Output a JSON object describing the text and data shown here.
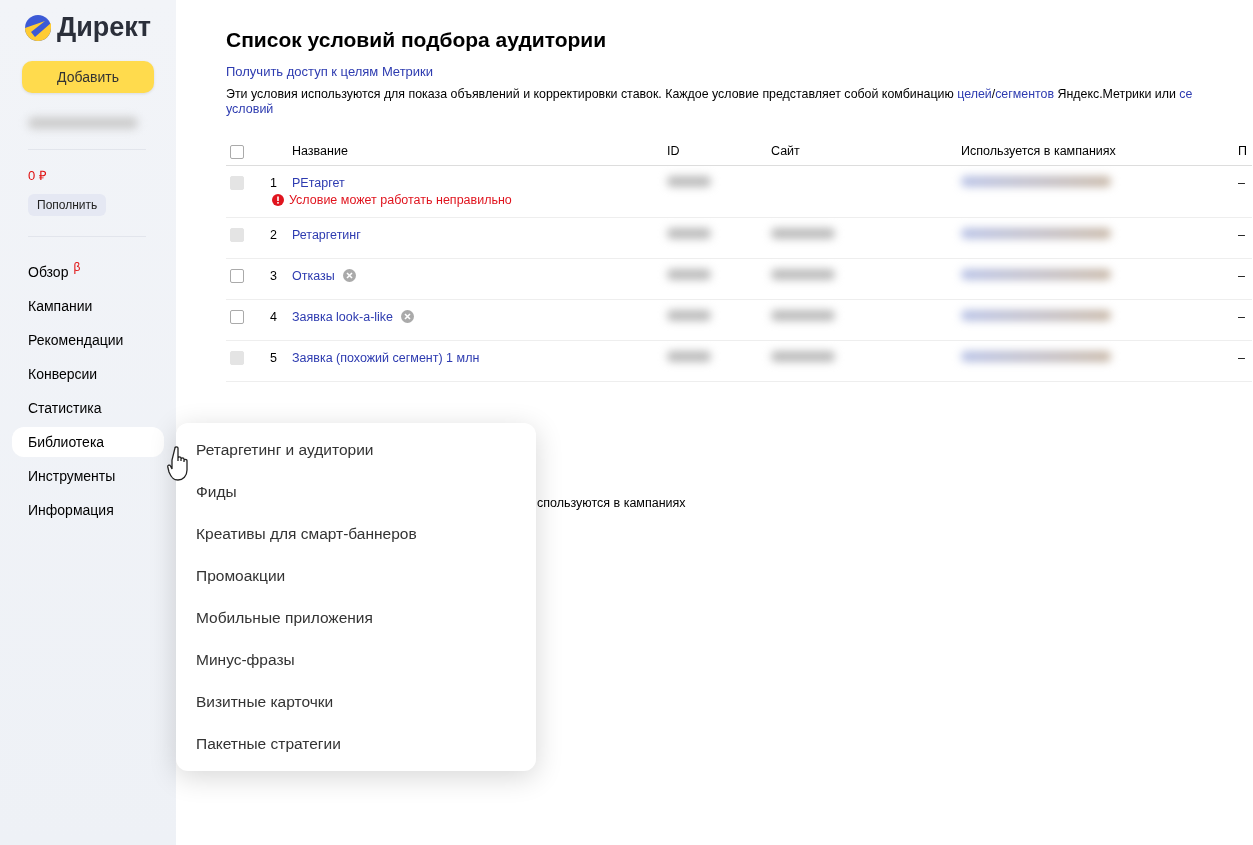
{
  "sidebar": {
    "logo": "Директ",
    "add_button": "Добавить",
    "balance": "0 ₽",
    "topup_button": "Пополнить",
    "items": [
      {
        "label": "Обзор",
        "badge": "β",
        "selected": false
      },
      {
        "label": "Кампании",
        "selected": false
      },
      {
        "label": "Рекомендации",
        "selected": false
      },
      {
        "label": "Конверсии",
        "selected": false
      },
      {
        "label": "Статистика",
        "selected": false
      },
      {
        "label": "Библиотека",
        "selected": true
      },
      {
        "label": "Инструменты",
        "selected": false
      },
      {
        "label": "Информация",
        "selected": false
      }
    ]
  },
  "page": {
    "title": "Список условий подбора аудитории",
    "metrika_link": "Получить доступ к целям Метрики",
    "description": [
      {
        "kind": "text",
        "text": "Эти условия используются для показа объявлений и корректировки ставок. Каждое условие представляет собой комбинацию "
      },
      {
        "kind": "link",
        "text": "целей"
      },
      {
        "kind": "text",
        "text": "/"
      },
      {
        "kind": "link",
        "text": "сегментов"
      },
      {
        "kind": "text",
        "text": " Яндекс.Метрики или "
      },
      {
        "kind": "link",
        "text": "се"
      }
    ],
    "description_line2": "условий",
    "background_note": "спользуются в кампаниях"
  },
  "table": {
    "select_all_checked": false,
    "columns": [
      "Название",
      "ID",
      "Сайт",
      "Используется в кампаниях",
      "П"
    ],
    "rows": [
      {
        "num": "1",
        "name": "РЕтаргет",
        "disabled": true,
        "removable": false,
        "warning": "Условие может работать неправильно",
        "has_site": false,
        "last": "–"
      },
      {
        "num": "2",
        "name": "Ретаргетинг",
        "disabled": true,
        "removable": false,
        "has_site": true,
        "last": "–"
      },
      {
        "num": "3",
        "name": "Отказы",
        "disabled": false,
        "removable": true,
        "has_site": true,
        "last": "–"
      },
      {
        "num": "4",
        "name": "Заявка look-a-like",
        "disabled": false,
        "removable": true,
        "has_site": true,
        "last": "–"
      },
      {
        "num": "5",
        "name": "Заявка (похожий сегмент) 1 млн",
        "disabled": true,
        "removable": false,
        "has_site": true,
        "last": "–"
      }
    ]
  },
  "menu": {
    "items": [
      "Ретаргетинг и аудитории",
      "Фиды",
      "Креативы для смарт-баннеров",
      "Промоакции",
      "Мобильные приложения",
      "Минус-фразы",
      "Визитные карточки",
      "Пакетные стратегии"
    ]
  }
}
